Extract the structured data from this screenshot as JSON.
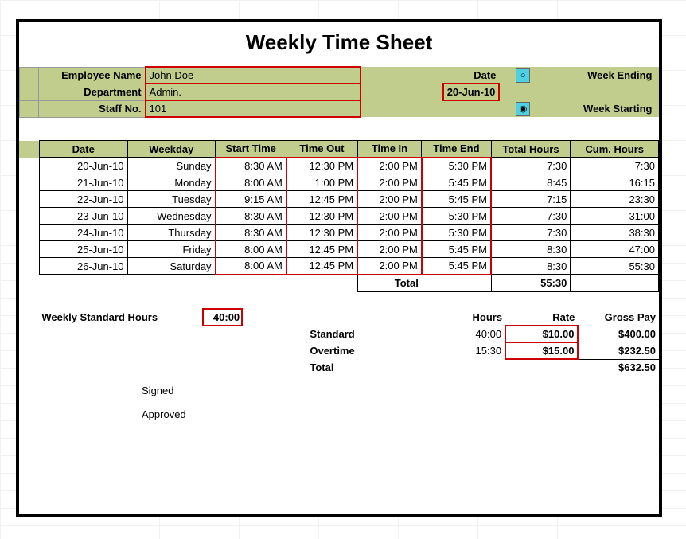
{
  "title": "Weekly Time Sheet",
  "labels": {
    "employee_name": "Employee Name",
    "department": "Department",
    "staff_no": "Staff No.",
    "date": "Date",
    "week_ending": "Week Ending",
    "week_starting": "Week Starting",
    "weekly_std_hours": "Weekly Standard Hours",
    "hours": "Hours",
    "rate": "Rate",
    "gross_pay": "Gross Pay",
    "standard": "Standard",
    "overtime": "Overtime",
    "total": "Total",
    "signed": "Signed",
    "approved": "Approved"
  },
  "info": {
    "employee_name": "John Doe",
    "department": "Admin.",
    "staff_no": "101",
    "date": "20-Jun-10"
  },
  "columns": {
    "date": "Date",
    "weekday": "Weekday",
    "start": "Start Time",
    "time_out": "Time Out",
    "time_in": "Time In",
    "time_end": "Time End",
    "total_hours": "Total Hours",
    "cum_hours": "Cum. Hours"
  },
  "rows": [
    {
      "date": "20-Jun-10",
      "weekday": "Sunday",
      "start": "8:30 AM",
      "out": "12:30 PM",
      "in": "2:00 PM",
      "end": "5:30 PM",
      "total": "7:30",
      "cum": "7:30"
    },
    {
      "date": "21-Jun-10",
      "weekday": "Monday",
      "start": "8:00 AM",
      "out": "1:00 PM",
      "in": "2:00 PM",
      "end": "5:45 PM",
      "total": "8:45",
      "cum": "16:15"
    },
    {
      "date": "22-Jun-10",
      "weekday": "Tuesday",
      "start": "9:15 AM",
      "out": "12:45 PM",
      "in": "2:00 PM",
      "end": "5:45 PM",
      "total": "7:15",
      "cum": "23:30"
    },
    {
      "date": "23-Jun-10",
      "weekday": "Wednesday",
      "start": "8:30 AM",
      "out": "12:30 PM",
      "in": "2:00 PM",
      "end": "5:30 PM",
      "total": "7:30",
      "cum": "31:00"
    },
    {
      "date": "24-Jun-10",
      "weekday": "Thursday",
      "start": "8:30 AM",
      "out": "12:30 PM",
      "in": "2:00 PM",
      "end": "5:30 PM",
      "total": "7:30",
      "cum": "38:30"
    },
    {
      "date": "25-Jun-10",
      "weekday": "Friday",
      "start": "8:00 AM",
      "out": "12:45 PM",
      "in": "2:00 PM",
      "end": "5:45 PM",
      "total": "8:30",
      "cum": "47:00"
    },
    {
      "date": "26-Jun-10",
      "weekday": "Saturday",
      "start": "8:00 AM",
      "out": "12:45 PM",
      "in": "2:00 PM",
      "end": "5:45 PM",
      "total": "8:30",
      "cum": "55:30"
    }
  ],
  "totals": {
    "grand_total_hours": "55:30",
    "weekly_std_hours": "40:00",
    "standard_hours": "40:00",
    "overtime_hours": "15:30",
    "standard_rate": "$10.00",
    "overtime_rate": "$15.00",
    "standard_pay": "$400.00",
    "overtime_pay": "$232.50",
    "total_pay": "$632.50"
  }
}
